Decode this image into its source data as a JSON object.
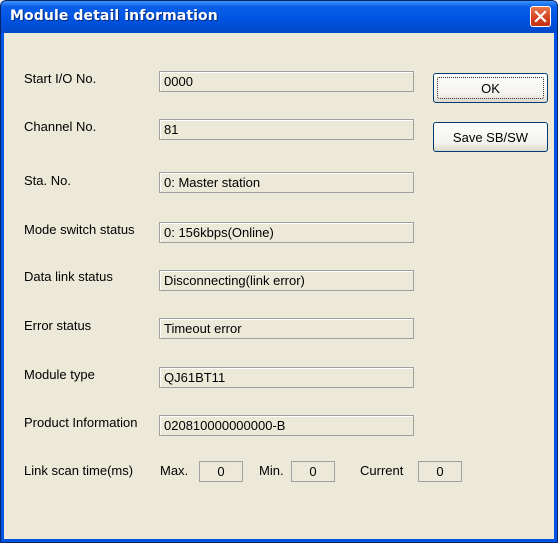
{
  "window": {
    "title": "Module detail information"
  },
  "fields": [
    {
      "label": "Start I/O No.",
      "value": "0000"
    },
    {
      "label": "Channel No.",
      "value": "81"
    },
    {
      "label": "Sta. No.",
      "value": "0: Master station"
    },
    {
      "label": "Mode switch status",
      "value": "0: 156kbps(Online)"
    },
    {
      "label": "Data link status",
      "value": "Disconnecting(link error)"
    },
    {
      "label": "Error status",
      "value": "Timeout error"
    },
    {
      "label": "Module type",
      "value": "QJ61BT11"
    },
    {
      "label": "Product Information",
      "value": "020810000000000-B"
    }
  ],
  "buttons": {
    "ok_label": "OK",
    "save_label": "Save SB/SW"
  },
  "scan_time": {
    "label": "Link scan time(ms)",
    "max_label": "Max.",
    "max_value": "0",
    "min_label": "Min.",
    "min_value": "0",
    "current_label": "Current",
    "current_value": "0"
  },
  "icons": {
    "close": "close-icon"
  },
  "colors": {
    "titlebar": "#0054e3",
    "close_button": "#d4401f",
    "dialog_background": "#ece9d8"
  }
}
